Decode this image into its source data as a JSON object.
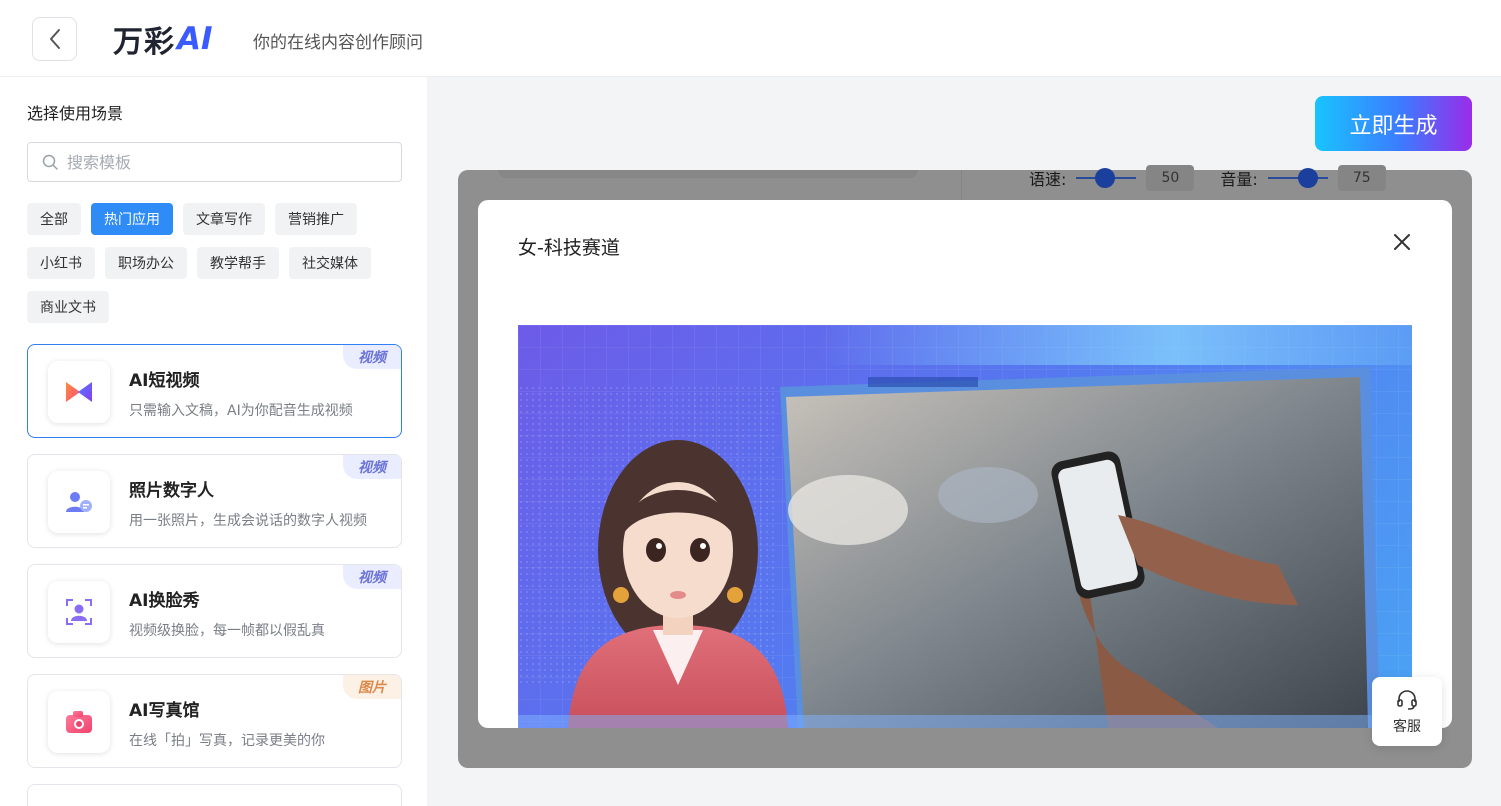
{
  "header": {
    "logo_cn": "万彩",
    "logo_ai": "AI",
    "slogan": "你的在线内容创作顾问"
  },
  "sidebar": {
    "title": "选择使用场景",
    "search_placeholder": "搜索模板",
    "tags": [
      "全部",
      "热门应用",
      "文章写作",
      "营销推广",
      "小红书",
      "职场办公",
      "教学帮手",
      "社交媒体",
      "商业文书"
    ],
    "active_tag": "热门应用",
    "cards": [
      {
        "title": "AI短视频",
        "desc": "只需输入文稿，AI为你配音生成视频",
        "badge": "视频"
      },
      {
        "title": "照片数字人",
        "desc": "用一张照片，生成会说话的数字人视频",
        "badge": "视频"
      },
      {
        "title": "AI换脸秀",
        "desc": "视频级换脸，每一帧都以假乱真",
        "badge": "视频"
      },
      {
        "title": "AI写真馆",
        "desc": "在线「拍」写真，记录更美的你",
        "badge": "图片"
      }
    ]
  },
  "main": {
    "generate_label": "立即生成",
    "speed_label": "语速:",
    "speed_value": "50",
    "volume_label": "音量:",
    "volume_value": "75"
  },
  "modal": {
    "title": "女-科技赛道"
  },
  "support": {
    "label": "客服"
  },
  "colors": {
    "primary": "#2f8cf6",
    "video_badge": "#6b72d8",
    "image_badge": "#dd8a4d"
  }
}
